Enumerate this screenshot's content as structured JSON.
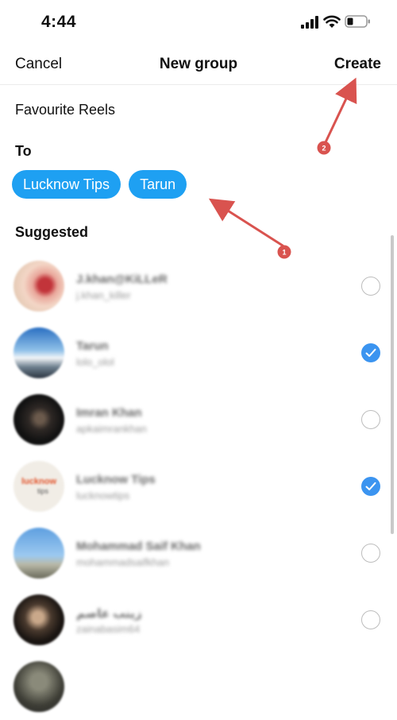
{
  "status_bar": {
    "time": "4:44"
  },
  "nav": {
    "cancel": "Cancel",
    "title": "New group",
    "create": "Create"
  },
  "group_name": "Favourite Reels",
  "to_label": "To",
  "recipients": [
    "Lucknow Tips",
    "Tarun"
  ],
  "suggested_label": "Suggested",
  "suggested": [
    {
      "name": "J.khan@KiLLeR",
      "handle": "j.khan_killer",
      "selected": false
    },
    {
      "name": "Tarun",
      "handle": "lolo_olol",
      "selected": true
    },
    {
      "name": "Imran Khan",
      "handle": "apkaimrankhan",
      "selected": false
    },
    {
      "name": "Lucknow Tips",
      "handle": "lucknowtips",
      "selected": true
    },
    {
      "name": "Mohammad Saif Khan",
      "handle": "mohammadsaifkhan",
      "selected": false
    },
    {
      "name": "زینب عاصم",
      "handle": "zainabasim64",
      "selected": false
    }
  ],
  "avatar_tip": {
    "line1": "lucknow",
    "line2": "tips"
  },
  "annotations": [
    {
      "number": "1"
    },
    {
      "number": "2"
    }
  ],
  "colors": {
    "chip": "#1ea0f2",
    "checked": "#3b94f0",
    "annotation": "#d9534f"
  }
}
